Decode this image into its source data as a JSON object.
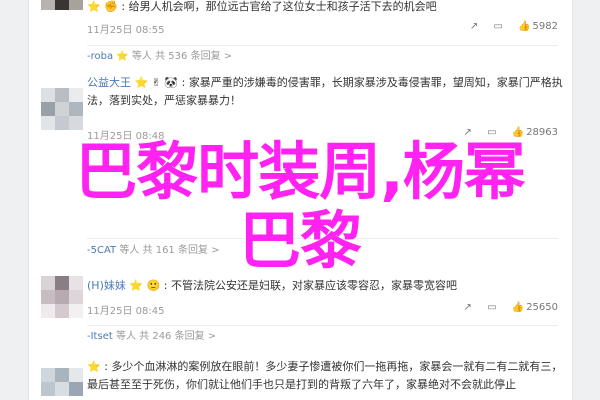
{
  "comments": [
    {
      "user": "",
      "icon": "⭐ ✊ :",
      "text": "给男人机会啊，那位远古官给了这位女士和孩子活下去的机会吧",
      "time": "11月25日 08:55",
      "acts": {
        "share": "↗",
        "comment": "▭",
        "like": "👍",
        "like_count": "5982"
      }
    },
    {
      "user": "",
      "icon": "",
      "text": "",
      "time": "",
      "sub": {
        "user": "-roba",
        "badge": "⭐",
        "mid": "等人 共",
        "count": "536",
        "rest": "条回复 >"
      }
    },
    {
      "user": "公益大王",
      "icon": "⭐ ✌ 🐼 :",
      "text": "家暴严重的涉嫌毒的侵害罪，长期家暴涉及毒侵害罪，望周知，家暴门严格执法，落到实处，严惩家暴暴力！",
      "time": "11月25日 08:48",
      "acts": {
        "share": "↗",
        "comment": "▭",
        "like": "👍",
        "like_count": "28963"
      }
    },
    {
      "user": "",
      "icon": "",
      "text": "",
      "time": "",
      "sub": {
        "user": "-5CAT",
        "badge": "",
        "mid": "等人 共",
        "count": "161",
        "rest": "条回复 >"
      }
    },
    {
      "user": "(H)妹妹",
      "icon": "⭐ 🙂 :",
      "text": "不管法院公安还是妇联，对家暴应该零容忍，家暴零宽容吧",
      "time": "11月25日 08:45",
      "acts": {
        "share": "↗",
        "comment": "▭",
        "like": "👍",
        "like_count": "25650"
      }
    },
    {
      "user": "",
      "icon": "",
      "text": "",
      "time": "",
      "sub": {
        "user": "-Itset",
        "badge": "",
        "mid": "等人 共",
        "count": "246",
        "rest": "条回复 >"
      }
    },
    {
      "user": "",
      "icon": "⭐ :",
      "text": "多少个血淋淋的案例放在眼前！多少妻子惨遭被你们一拖再拖，家暴会一就有二有二就有三，最后甚至至于死伤，你们就让他们手也只是打到的背叛了六年了，家暴绝对不会就此停止",
      "time": "",
      "acts": {
        "share": "",
        "comment": "",
        "like": "",
        "like_count": ""
      }
    }
  ],
  "overlay": {
    "line1": "巴黎时装周,杨幂",
    "line2": "巴黎"
  },
  "colors": {
    "overlay": "#ff22f0",
    "link": "#4a7bb7",
    "text": "#333333",
    "meta": "#9a9a9a"
  }
}
